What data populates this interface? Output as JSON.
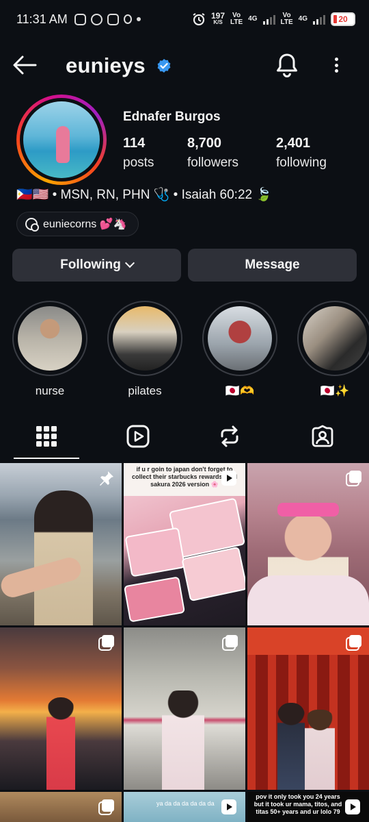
{
  "status_bar": {
    "time": "11:31 AM",
    "speed_value": "197",
    "speed_unit": "K/S",
    "net1_top": "Vo",
    "net1_bottom": "LTE",
    "net1_type": "4G",
    "net2_top": "Vo",
    "net2_bottom": "LTE",
    "net2_type": "4G",
    "battery": "20"
  },
  "header": {
    "username": "eunieys"
  },
  "profile": {
    "full_name": "Ednafer Burgos",
    "posts_count": "114",
    "posts_label": "posts",
    "followers_count": "8,700",
    "followers_label": "followers",
    "following_count": "2,401",
    "following_label": "following",
    "bio": "🇵🇭🇺🇸 • MSN, RN, PHN 🩺 • Isaiah 60:22 🍃",
    "threads_handle": "euniecorns 💕🦄"
  },
  "actions": {
    "following_label": "Following",
    "message_label": "Message"
  },
  "highlights": [
    {
      "label": "nurse"
    },
    {
      "label": "pilates"
    },
    {
      "label": "🇯🇵🫶"
    },
    {
      "label": "🇯🇵✨"
    }
  ],
  "posts": [
    {
      "caption": ""
    },
    {
      "caption": "if u r goin to japan don't forget to collect their starbucks rewards card sakura 2026 version 🌸"
    },
    {
      "caption": ""
    },
    {
      "caption": ""
    },
    {
      "caption": ""
    },
    {
      "caption": ""
    },
    {
      "caption": ""
    },
    {
      "caption": "ya da da da da da da"
    },
    {
      "caption": "pov it only took you 24 years but it took ur mama, titos, and titas 50+ years and ur lolo 79"
    }
  ],
  "colors": {
    "background": "#0c0f14",
    "button": "#2e3038",
    "verified": "#3897f0",
    "battery_low": "#e53935"
  }
}
